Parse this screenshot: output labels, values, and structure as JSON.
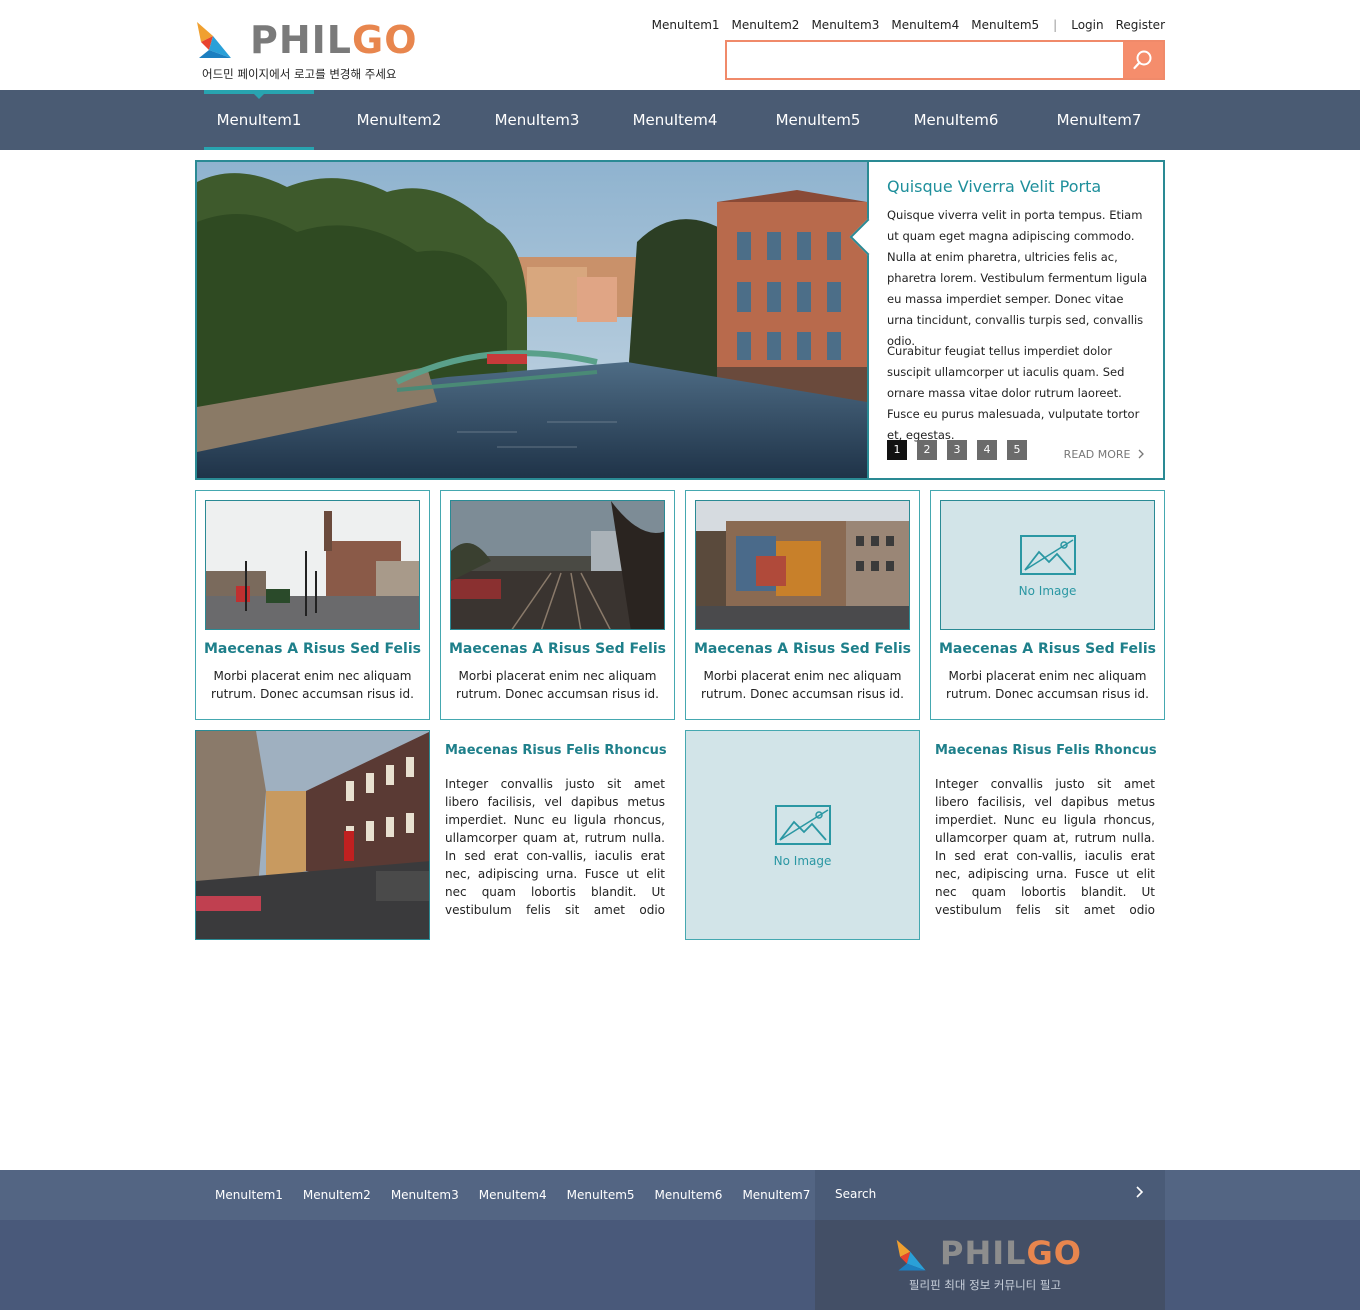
{
  "header": {
    "logo_part1": "PHIL",
    "logo_part2": "GO",
    "logo_tagline": "어드민 페이지에서 로고를 변경해 주세요",
    "top_links": [
      "MenuItem1",
      "MenuItem2",
      "MenuItem3",
      "MenuItem4",
      "MenuItem5"
    ],
    "separator": "|",
    "login": "Login",
    "register": "Register",
    "search_value": ""
  },
  "nav": {
    "items": [
      "MenuItem1",
      "MenuItem2",
      "MenuItem3",
      "MenuItem4",
      "MenuItem5",
      "MenuItem6",
      "MenuItem7"
    ],
    "active_index": 0
  },
  "hero": {
    "title": "Quisque Viverra Velit Porta",
    "paragraph1": "Quisque viverra velit in porta tempus. Etiam ut quam eget magna adipiscing commodo. Nulla at enim pharetra, ultricies felis ac, pharetra lorem. Vestibulum fermentum ligula eu massa imperdiet semper. Donec vitae urna tincidunt, convallis turpis sed, convallis odio.",
    "paragraph2": "Curabitur feugiat tellus imperdiet dolor suscipit ullamcorper ut iaculis quam. Sed ornare massa vitae dolor rutrum laoreet. Fusce eu purus malesuada, vulputate tortor et, egestas.",
    "pages": [
      "1",
      "2",
      "3",
      "4",
      "5"
    ],
    "current_page": "1",
    "read_more": "READ MORE"
  },
  "cards": [
    {
      "title": "Maecenas A Risus Sed Felis",
      "text": "Morbi placerat enim nec aliquam rutrum. Donec accumsan risus id."
    },
    {
      "title": "Maecenas A Risus Sed Felis",
      "text": "Morbi placerat enim nec aliquam rutrum. Donec accumsan risus id."
    },
    {
      "title": "Maecenas A Risus Sed Felis",
      "text": "Morbi placerat enim nec aliquam rutrum. Donec accumsan risus id."
    },
    {
      "title": "Maecenas A Risus Sed Felis",
      "text": "Morbi placerat enim nec aliquam rutrum. Donec accumsan risus id.",
      "no_image_label": "No Image"
    }
  ],
  "features": [
    {
      "title": "Maecenas Risus Felis Rhoncus",
      "text": "Integer convallis justo sit amet libero facilisis, vel dapibus metus imperdiet. Nunc eu ligula rhoncus, ullamcorper quam at, rutrum nulla. In sed erat con-vallis, iaculis erat nec, adipiscing urna. Fusce ut elit nec quam lobortis blandit. Ut vestibulum felis sit amet odio eleifend molestie. Aliquam nec eros vel arcu"
    },
    {
      "title": "Maecenas Risus Felis Rhoncus",
      "text": "Integer convallis justo sit amet libero facilisis, vel dapibus metus imperdiet. Nunc eu ligula rhoncus, ullamcorper quam at, rutrum nulla. In sed erat con-vallis, iaculis erat nec, adipiscing urna. Fusce ut elit nec quam lobortis blandit. Ut vestibulum felis sit amet odio eleifend molestie. Aliquam nec eros vel arcu",
      "no_image_label": "No Image"
    }
  ],
  "footer": {
    "links": [
      "MenuItem1",
      "MenuItem2",
      "MenuItem3",
      "MenuItem4",
      "MenuItem5",
      "MenuItem6",
      "MenuItem7"
    ],
    "search_label": "Search",
    "logo_part1": "PHIL",
    "logo_part2": "GO",
    "logo_tagline": "필리핀 최대 정보 커뮤니티 필고"
  },
  "colors": {
    "accent": "#2a8a94",
    "nav_bg": "#4a5b73",
    "search_accent": "#f58d6c",
    "logo_orange": "#e8864e"
  }
}
